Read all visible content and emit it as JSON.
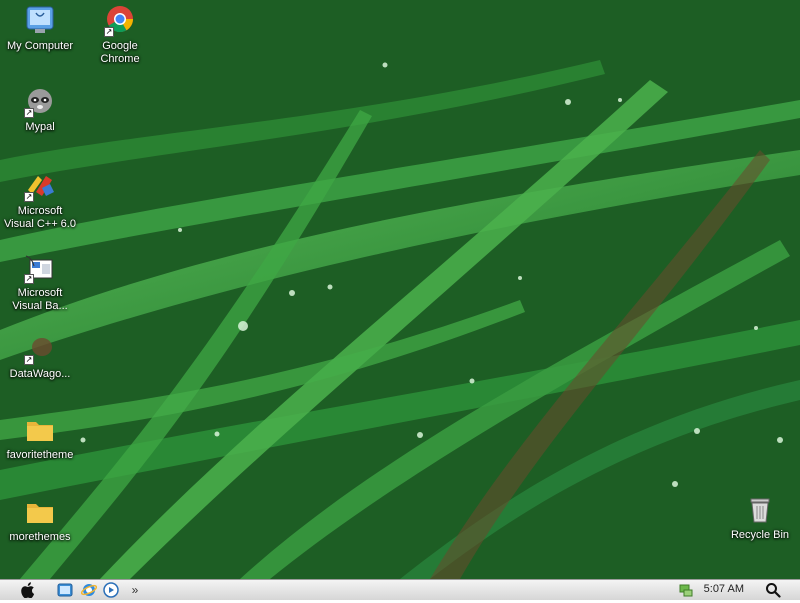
{
  "desktop": {
    "icons": [
      {
        "label": "My Computer"
      },
      {
        "label": "Google\nChrome"
      },
      {
        "label": "Mypal"
      },
      {
        "label": "Microsoft\nVisual C++ 6.0"
      },
      {
        "label": "Microsoft\nVisual Ba..."
      },
      {
        "label": "DataWago..."
      },
      {
        "label": "favoritetheme"
      },
      {
        "label": "morethemes"
      },
      {
        "label": "Recycle Bin"
      }
    ]
  },
  "taskbar": {
    "overflow": "»",
    "clock": "5:07 AM"
  },
  "colors": {
    "wallpaper_green": "#2f8a3a",
    "taskbar_bg": "#e6e6e6",
    "folder_yellow": "#f3c94b"
  }
}
